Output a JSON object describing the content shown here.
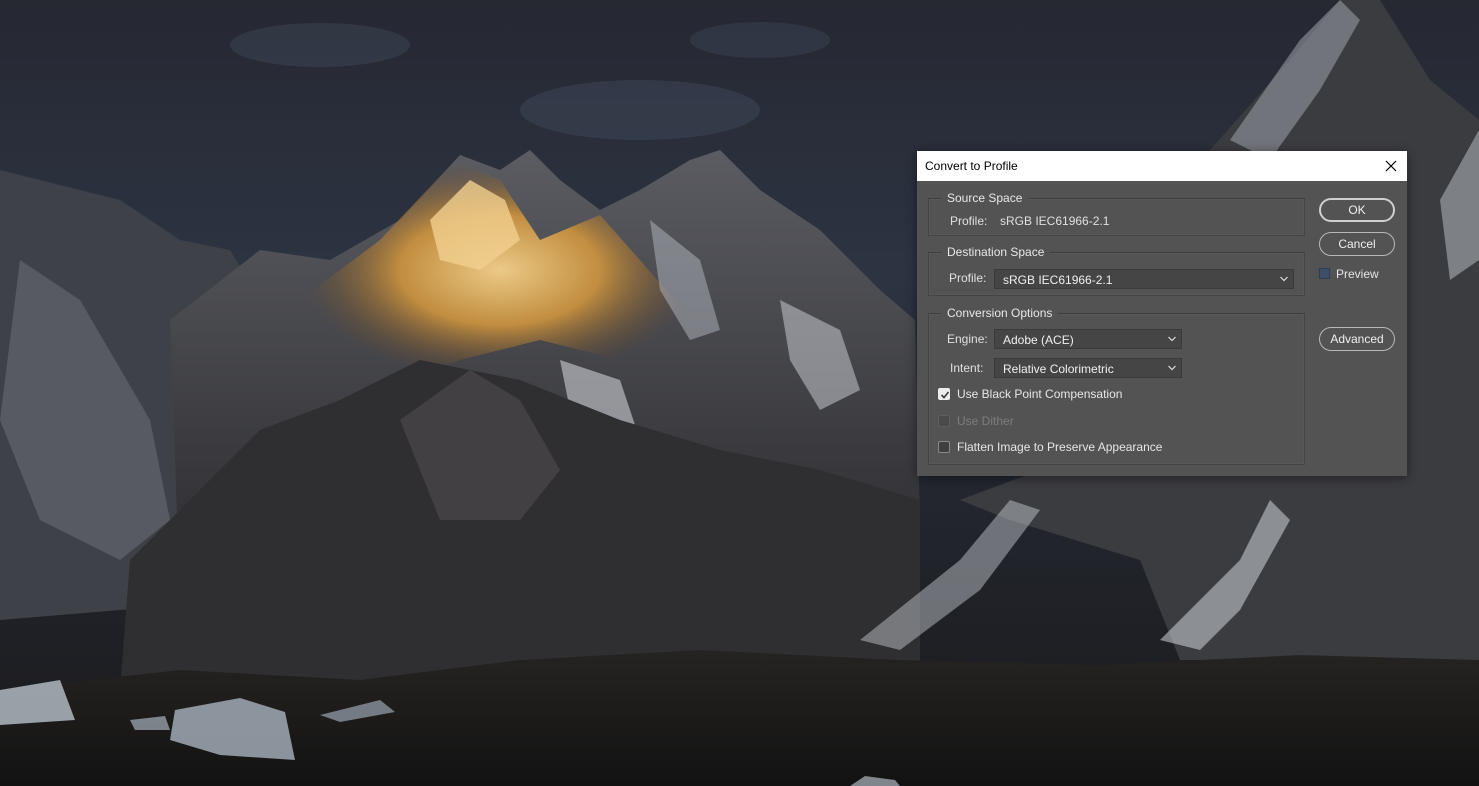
{
  "dialog": {
    "title": "Convert to Profile",
    "close_icon": "close-icon",
    "source_space": {
      "legend": "Source Space",
      "profile_label": "Profile:",
      "profile_value": "sRGB IEC61966-2.1"
    },
    "destination_space": {
      "legend": "Destination Space",
      "profile_label": "Profile:",
      "profile_value": "sRGB IEC61966-2.1"
    },
    "conversion_options": {
      "legend": "Conversion Options",
      "engine_label": "Engine:",
      "engine_value": "Adobe (ACE)",
      "intent_label": "Intent:",
      "intent_value": "Relative Colorimetric",
      "black_point": {
        "label": "Use Black Point Compensation",
        "checked": true,
        "enabled": true
      },
      "dither": {
        "label": "Use Dither",
        "checked": false,
        "enabled": false
      },
      "flatten": {
        "label": "Flatten Image to Preserve Appearance",
        "checked": false,
        "enabled": true
      }
    },
    "buttons": {
      "ok": "OK",
      "cancel": "Cancel",
      "advanced": "Advanced"
    },
    "preview": {
      "label": "Preview",
      "checked": false
    }
  },
  "colors": {
    "dialog_bg": "#535353",
    "field_bg": "#454545",
    "titlebar_bg": "#ffffff",
    "preview_check": "#3c4e68"
  }
}
